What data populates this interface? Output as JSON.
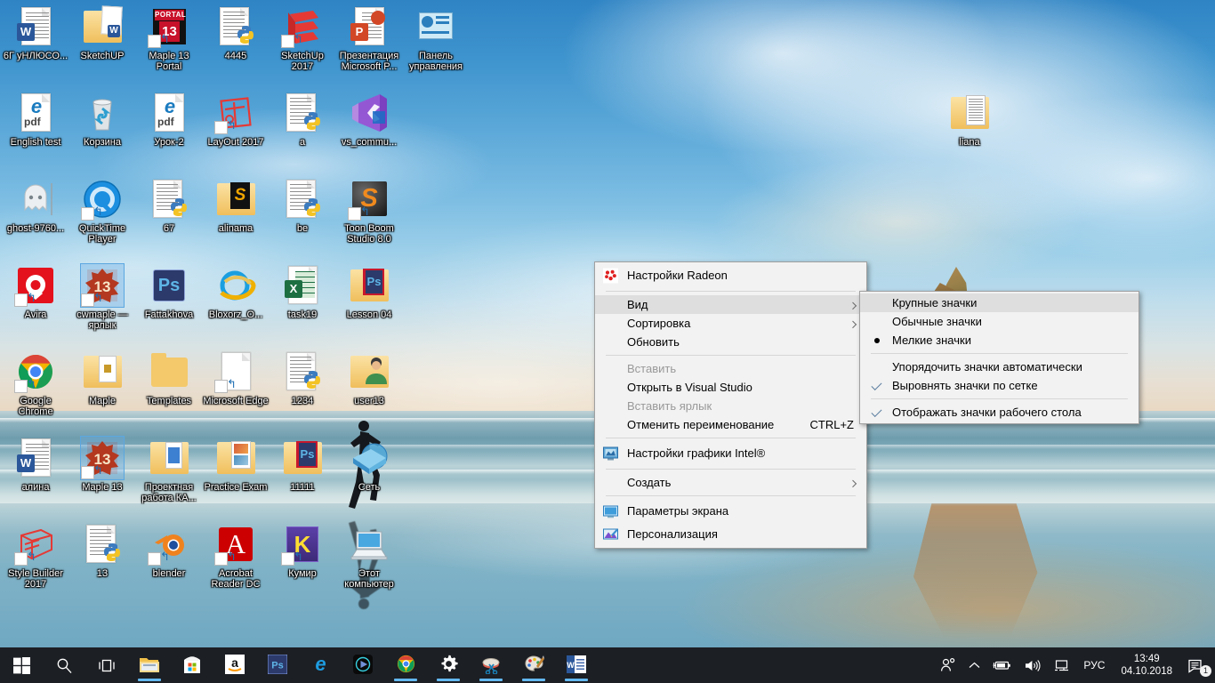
{
  "desktop": {
    "icons": [
      {
        "label": "6Г уНЛЮСО...",
        "col": 0,
        "row": 0,
        "type": "word-doc"
      },
      {
        "label": "SketchUP",
        "col": 1,
        "row": 0,
        "type": "folder-word"
      },
      {
        "label": "Maple 13 Portal",
        "col": 2,
        "row": 0,
        "type": "maple-portal",
        "shortcut": true
      },
      {
        "label": "4445",
        "col": 3,
        "row": 0,
        "type": "python-doc"
      },
      {
        "label": "SketchUp 2017",
        "col": 4,
        "row": 0,
        "type": "sketchup",
        "shortcut": true
      },
      {
        "label": "Презентация Microsoft P...",
        "col": 5,
        "row": 0,
        "type": "powerpoint-doc"
      },
      {
        "label": "Панель управления",
        "col": 6,
        "row": 0,
        "type": "control-panel"
      },
      {
        "label": "English test",
        "col": 0,
        "row": 1,
        "type": "pdf-edge"
      },
      {
        "label": "Корзина",
        "col": 1,
        "row": 1,
        "type": "recycle-bin"
      },
      {
        "label": "Урок-2",
        "col": 2,
        "row": 1,
        "type": "pdf-edge"
      },
      {
        "label": "LayOut 2017",
        "col": 3,
        "row": 1,
        "type": "layout",
        "shortcut": true
      },
      {
        "label": "a",
        "col": 4,
        "row": 1,
        "type": "python-doc"
      },
      {
        "label": "vs_commu...",
        "col": 5,
        "row": 1,
        "type": "visual-studio"
      },
      {
        "label": "liana",
        "col": 14,
        "row": 1,
        "type": "folder-open-docs"
      },
      {
        "label": "ghost-9760...",
        "col": 0,
        "row": 2,
        "type": "ghost"
      },
      {
        "label": "QuickTime Player",
        "col": 1,
        "row": 2,
        "type": "quicktime",
        "shortcut": true
      },
      {
        "label": "67",
        "col": 2,
        "row": 2,
        "type": "python-doc"
      },
      {
        "label": "alinama",
        "col": 3,
        "row": 2,
        "type": "folder-sublime"
      },
      {
        "label": "be",
        "col": 4,
        "row": 2,
        "type": "python-doc"
      },
      {
        "label": "Toon Boom Studio 8.0",
        "col": 5,
        "row": 2,
        "type": "toonboom",
        "shortcut": true
      },
      {
        "label": "Avira",
        "col": 0,
        "row": 3,
        "type": "avira",
        "shortcut": true
      },
      {
        "label": "cwmaple — ярлык",
        "col": 1,
        "row": 3,
        "type": "maple13",
        "shortcut": true,
        "selected": true
      },
      {
        "label": "Fattakhova",
        "col": 2,
        "row": 3,
        "type": "photoshop"
      },
      {
        "label": "Bloxorz_O...",
        "col": 3,
        "row": 3,
        "type": "internet-explorer"
      },
      {
        "label": "task19",
        "col": 4,
        "row": 3,
        "type": "excel-doc"
      },
      {
        "label": "Lesson 04",
        "col": 5,
        "row": 3,
        "type": "folder-ps"
      },
      {
        "label": "Google Chrome",
        "col": 0,
        "row": 4,
        "type": "chrome",
        "shortcut": true
      },
      {
        "label": "Maple",
        "col": 1,
        "row": 4,
        "type": "folder-doc"
      },
      {
        "label": "Templates",
        "col": 2,
        "row": 4,
        "type": "folder"
      },
      {
        "label": "Microsoft Edge",
        "col": 3,
        "row": 4,
        "type": "edge",
        "shortcut": true
      },
      {
        "label": "1234",
        "col": 4,
        "row": 4,
        "type": "python-doc"
      },
      {
        "label": "user13",
        "col": 5,
        "row": 4,
        "type": "folder-user"
      },
      {
        "label": "алина",
        "col": 0,
        "row": 5,
        "type": "word-doc"
      },
      {
        "label": "Maple 13",
        "col": 1,
        "row": 5,
        "type": "maple13",
        "shortcut": true,
        "selected": true
      },
      {
        "label": "Проектная работа КА...",
        "col": 2,
        "row": 5,
        "type": "folder-blue"
      },
      {
        "label": "Practice Exam",
        "col": 3,
        "row": 5,
        "type": "folder-pic"
      },
      {
        "label": "11111",
        "col": 4,
        "row": 5,
        "type": "folder-ps"
      },
      {
        "label": "Сеть",
        "col": 5,
        "row": 5,
        "type": "network"
      },
      {
        "label": "Style Builder 2017",
        "col": 0,
        "row": 6,
        "type": "style-builder",
        "shortcut": true
      },
      {
        "label": "13",
        "col": 1,
        "row": 6,
        "type": "python-doc"
      },
      {
        "label": "blender",
        "col": 2,
        "row": 6,
        "type": "blender",
        "shortcut": true
      },
      {
        "label": "Acrobat Reader DC",
        "col": 3,
        "row": 6,
        "type": "acrobat",
        "shortcut": true
      },
      {
        "label": "Кумир",
        "col": 4,
        "row": 6,
        "type": "kumir",
        "shortcut": true
      },
      {
        "label": "Этот компьютер",
        "col": 5,
        "row": 6,
        "type": "this-pc"
      }
    ]
  },
  "context_menu": {
    "items": [
      {
        "id": "radeon",
        "label": "Настройки Radeon",
        "icon": "radeon-icon",
        "type": "item"
      },
      {
        "id": "sep1",
        "type": "separator"
      },
      {
        "id": "view",
        "label": "Вид",
        "type": "submenu",
        "highlighted": true
      },
      {
        "id": "sort",
        "label": "Сортировка",
        "type": "submenu"
      },
      {
        "id": "refresh",
        "label": "Обновить",
        "type": "item"
      },
      {
        "id": "sep2",
        "type": "separator"
      },
      {
        "id": "paste",
        "label": "Вставить",
        "type": "item",
        "disabled": true
      },
      {
        "id": "open-vs",
        "label": "Открыть в Visual Studio",
        "type": "item"
      },
      {
        "id": "paste-shortcut",
        "label": "Вставить ярлык",
        "type": "item",
        "disabled": true
      },
      {
        "id": "undo-rename",
        "label": "Отменить переименование",
        "accelerator": "CTRL+Z",
        "type": "item"
      },
      {
        "id": "sep3",
        "type": "separator"
      },
      {
        "id": "intel",
        "label": "Настройки графики Intel®",
        "icon": "intel-graphics-icon",
        "type": "item"
      },
      {
        "id": "sep4",
        "type": "separator"
      },
      {
        "id": "create",
        "label": "Создать",
        "type": "submenu"
      },
      {
        "id": "sep5",
        "type": "separator"
      },
      {
        "id": "display",
        "label": "Параметры экрана",
        "icon": "display-icon",
        "type": "item"
      },
      {
        "id": "personalize",
        "label": "Персонализация",
        "icon": "personalization-icon",
        "type": "item"
      }
    ]
  },
  "view_submenu": {
    "items": [
      {
        "id": "large",
        "label": "Крупные значки",
        "mark": "none",
        "highlighted": true
      },
      {
        "id": "medium",
        "label": "Обычные значки",
        "mark": "none"
      },
      {
        "id": "small",
        "label": "Мелкие значки",
        "mark": "radio"
      },
      {
        "id": "sepA",
        "type": "separator"
      },
      {
        "id": "autoarrange",
        "label": "Упорядочить значки автоматически",
        "mark": "none"
      },
      {
        "id": "align",
        "label": "Выровнять значки по сетке",
        "mark": "check"
      },
      {
        "id": "sepB",
        "type": "separator"
      },
      {
        "id": "show",
        "label": "Отображать значки рабочего стола",
        "mark": "check"
      }
    ]
  },
  "taskbar": {
    "start": {
      "name": "start-button",
      "tooltip": "Пуск"
    },
    "search": {
      "name": "search-button"
    },
    "taskview": {
      "name": "task-view-button"
    },
    "pinned": [
      {
        "id": "explorer",
        "label": "Проводник",
        "icon": "file-explorer-icon",
        "running": true
      },
      {
        "id": "store",
        "label": "Microsoft Store",
        "icon": "store-icon",
        "running": false
      },
      {
        "id": "amazon",
        "label": "Amazon",
        "icon": "amazon-icon",
        "running": false
      },
      {
        "id": "photoshop",
        "label": "Adobe Photoshop",
        "icon": "photoshop-icon",
        "running": false
      },
      {
        "id": "edge",
        "label": "Microsoft Edge",
        "icon": "edge-icon",
        "running": false
      },
      {
        "id": "movies",
        "label": "Кино и ТВ",
        "icon": "movies-tv-icon",
        "running": false
      },
      {
        "id": "chrome",
        "label": "Google Chrome",
        "icon": "chrome-icon",
        "running": true
      },
      {
        "id": "settings",
        "label": "Параметры",
        "icon": "settings-gear-icon",
        "running": true
      },
      {
        "id": "snip",
        "label": "Ножницы",
        "icon": "snipping-tool-icon",
        "running": true
      },
      {
        "id": "paint",
        "label": "Paint",
        "icon": "paint-palette-icon",
        "running": true
      },
      {
        "id": "word",
        "label": "Microsoft Word",
        "icon": "word-icon",
        "running": true
      }
    ],
    "tray": {
      "people_icon": "people-icon",
      "chevron_icon": "show-hidden-icons-chevron",
      "battery_icon": "battery-charging-icon",
      "volume_icon": "volume-icon",
      "network_icon": "network-icon",
      "language": "РУС",
      "time": "13:49",
      "date": "04.10.2018",
      "action_center_icon": "action-center-icon",
      "notification_count": "1"
    }
  },
  "colors": {
    "menu_bg": "#f2f2f2",
    "menu_border": "#a0a0a0",
    "menu_highlight": "#dededf",
    "taskbar_bg": "#1c1f24",
    "accent": "#63b8f0",
    "check_mark": "#5d7fa0"
  }
}
